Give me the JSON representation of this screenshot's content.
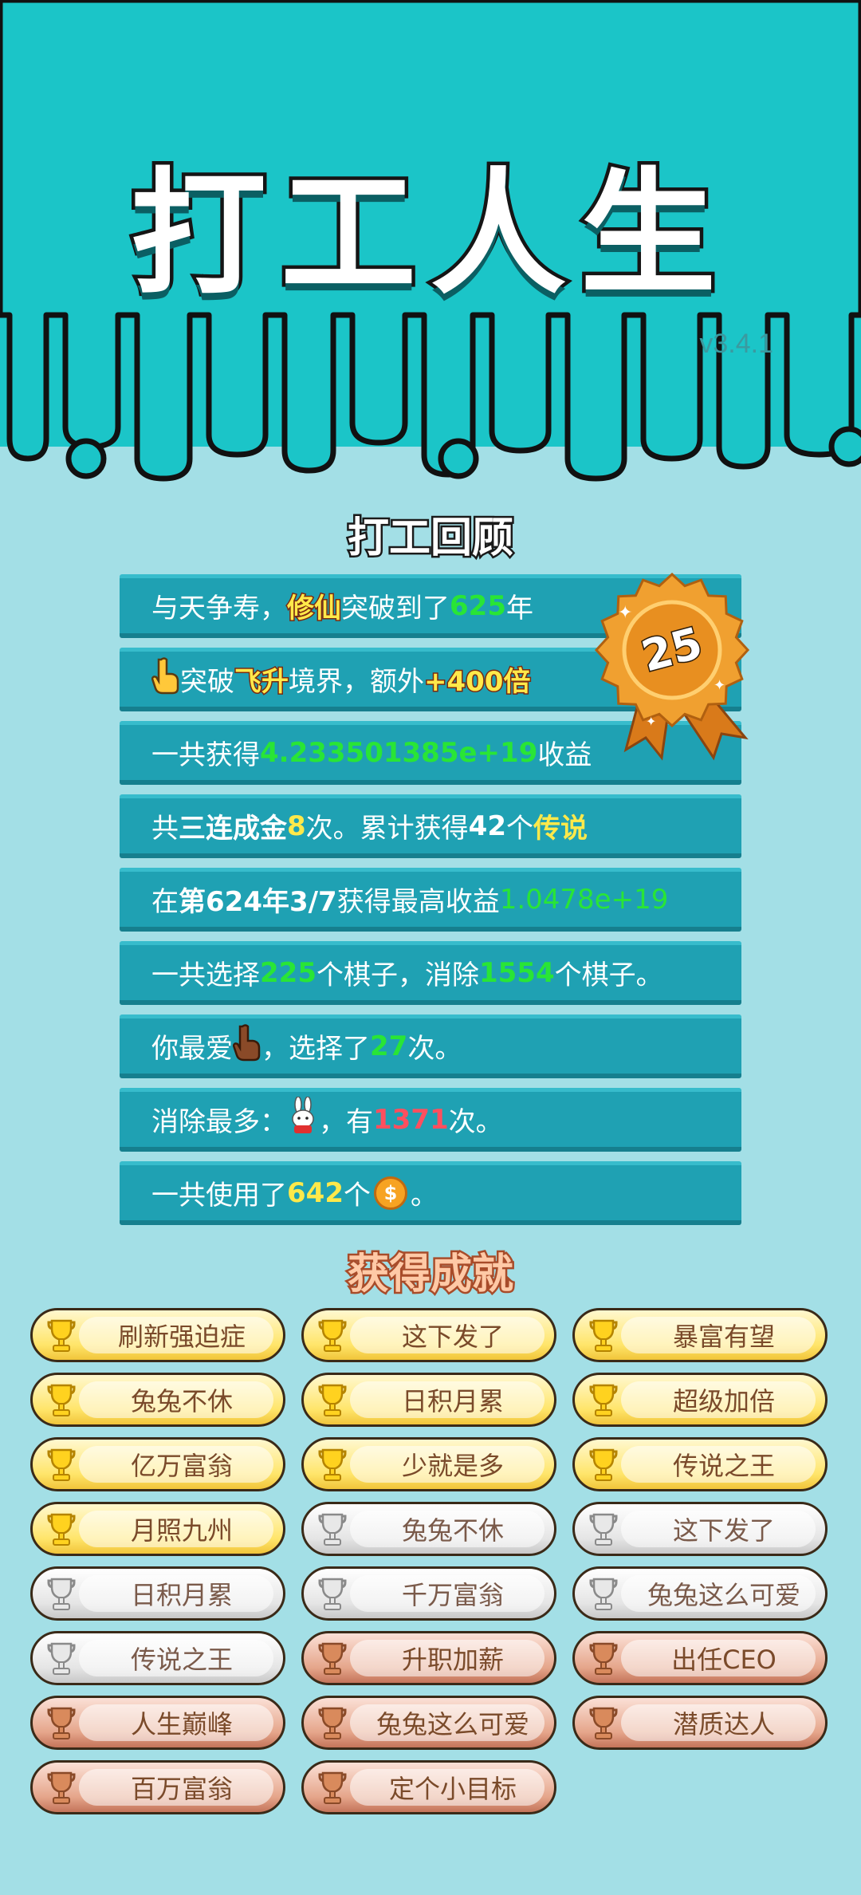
{
  "app": {
    "title": "打工人生",
    "version": "v3.4.1"
  },
  "review": {
    "title": "打工回顾",
    "badge_number": "25",
    "rows": [
      {
        "pre": "与天争寿，",
        "h1": "修仙",
        "mid": "突破到了",
        "v1": "625",
        "post": "年"
      },
      {
        "icon": "pointing-hand",
        "pre": "突破",
        "h1": "飞升",
        "mid": "境界，额外",
        "v1": "+400倍"
      },
      {
        "pre": "一共获得",
        "v1": "4.233501385e+19",
        "post": "收益"
      },
      {
        "pre": "共",
        "h1": "三连成金",
        "v1": "8",
        "mid": "次。累计获得",
        "v2": "42",
        "mid2": "个",
        "v3": "传说"
      },
      {
        "pre": "在 ",
        "h1": "第624年3/7",
        "mid": " 获得最高收益",
        "v1": "1.0478e+19"
      },
      {
        "pre": "一共选择",
        "v1": "225",
        "mid": "个棋子，消除",
        "v2": "1554",
        "post": "个棋子。"
      },
      {
        "pre": "你最爱",
        "icon": "brown-pointing-hand",
        "mid": "，选择了",
        "v1": "27",
        "post": "次。"
      },
      {
        "pre": "消除最多：",
        "icon": "rabbit",
        "mid": "，有",
        "v1": "1371",
        "post": "次。"
      },
      {
        "pre": "一共使用了",
        "v1": "642",
        "mid": "个",
        "icon": "coin",
        "coin_symbol": "$",
        "post": "。"
      }
    ]
  },
  "achievements": {
    "title": "获得成就",
    "items": [
      {
        "label": "刷新强迫症",
        "tier": "gold"
      },
      {
        "label": "这下发了",
        "tier": "gold"
      },
      {
        "label": "暴富有望",
        "tier": "gold"
      },
      {
        "label": "兔兔不休",
        "tier": "gold"
      },
      {
        "label": "日积月累",
        "tier": "gold"
      },
      {
        "label": "超级加倍",
        "tier": "gold"
      },
      {
        "label": "亿万富翁",
        "tier": "gold"
      },
      {
        "label": "少就是多",
        "tier": "gold"
      },
      {
        "label": "传说之王",
        "tier": "gold"
      },
      {
        "label": "月照九州",
        "tier": "gold"
      },
      {
        "label": "兔兔不休",
        "tier": "silver"
      },
      {
        "label": "这下发了",
        "tier": "silver"
      },
      {
        "label": "日积月累",
        "tier": "silver"
      },
      {
        "label": "千万富翁",
        "tier": "silver"
      },
      {
        "label": "兔兔这么可爱",
        "tier": "silver"
      },
      {
        "label": "传说之王",
        "tier": "silver"
      },
      {
        "label": "升职加薪",
        "tier": "bronze"
      },
      {
        "label": "出任CEO",
        "tier": "bronze"
      },
      {
        "label": "人生巅峰",
        "tier": "bronze"
      },
      {
        "label": "兔兔这么可爱",
        "tier": "bronze"
      },
      {
        "label": "潜质达人",
        "tier": "bronze"
      },
      {
        "label": "百万富翁",
        "tier": "bronze"
      },
      {
        "label": "定个小目标",
        "tier": "bronze"
      }
    ]
  },
  "colors": {
    "top_bg": "#1bc5c8",
    "page_bg": "#a3dfe6",
    "row_bg": "#1fa1b3",
    "highlight_yellow": "#ffe94a",
    "highlight_green": "#29e536",
    "highlight_red": "#ff4f5e"
  }
}
